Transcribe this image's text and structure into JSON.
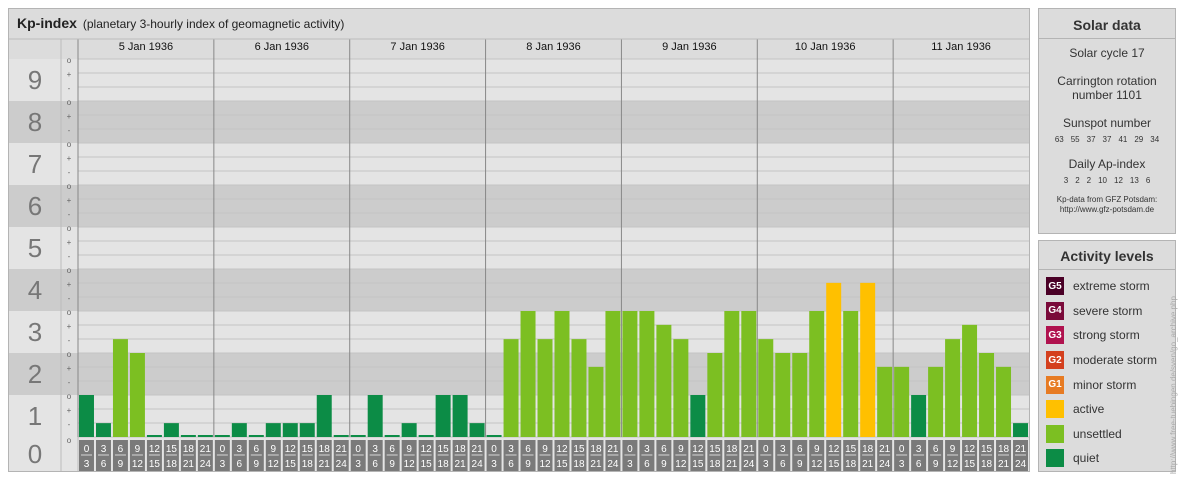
{
  "header": {
    "title": "Kp-index",
    "subtitle": "(planetary 3-hourly index of geomagnetic activity)"
  },
  "solar": {
    "title": "Solar data",
    "cycle": "Solar cycle 17",
    "carrington": "Carrington rotation number 1101",
    "sunspot_label": "Sunspot number",
    "sunspot_values": [
      "63",
      "55",
      "37",
      "37",
      "41",
      "29",
      "34"
    ],
    "ap_label": "Daily Ap-index",
    "ap_values": [
      "3",
      "2",
      "2",
      "10",
      "12",
      "13",
      "6"
    ],
    "source": "Kp-data from GFZ Potsdam:",
    "source_url": "http://www.gfz-potsdam.de"
  },
  "activity": {
    "title": "Activity levels",
    "levels": [
      {
        "code": "G5",
        "label": "extreme storm",
        "color": "#4a0026"
      },
      {
        "code": "G4",
        "label": "severe storm",
        "color": "#7a0a3a"
      },
      {
        "code": "G3",
        "label": "strong storm",
        "color": "#b0124e"
      },
      {
        "code": "G2",
        "label": "moderate storm",
        "color": "#d4401e"
      },
      {
        "code": "G1",
        "label": "minor storm",
        "color": "#e77b22"
      },
      {
        "code": "",
        "label": "active",
        "color": "#ffc000"
      },
      {
        "code": "",
        "label": "unsettled",
        "color": "#7cbf22"
      },
      {
        "code": "",
        "label": "quiet",
        "color": "#0c8c46"
      }
    ]
  },
  "watermark": "http://www.free-tuebingen.de/sven/go_archive.php",
  "chart_data": {
    "type": "bar",
    "title": "Kp-index",
    "ylim": [
      0,
      9
    ],
    "y_ticks": [
      "0",
      "1",
      "2",
      "3",
      "4",
      "5",
      "6",
      "7",
      "8",
      "9"
    ],
    "sub_ticks": [
      "o",
      "-",
      "+"
    ],
    "days": [
      "5 Jan 1936",
      "6 Jan 1936",
      "7 Jan 1936",
      "8 Jan 1936",
      "9 Jan 1936",
      "10 Jan 1936",
      "11 Jan 1936"
    ],
    "interval_start": [
      "0",
      "3",
      "6",
      "9",
      "12",
      "15",
      "18",
      "21"
    ],
    "interval_end": [
      "3",
      "6",
      "9",
      "12",
      "15",
      "18",
      "21",
      "24"
    ],
    "values": [
      1.0,
      0.33,
      2.33,
      2.0,
      0,
      0.33,
      0,
      0,
      0,
      0.33,
      0,
      0.33,
      0.33,
      0.33,
      1.0,
      0,
      0,
      1.0,
      0,
      0.33,
      0,
      1.0,
      1.0,
      0.33,
      0,
      2.33,
      3.0,
      2.33,
      3.0,
      2.33,
      1.67,
      3.0,
      3.0,
      3.0,
      2.67,
      2.33,
      1.0,
      2.0,
      3.0,
      3.0,
      2.33,
      2.0,
      2.0,
      3.0,
      3.67,
      3.0,
      3.67,
      1.67,
      1.67,
      1.0,
      1.67,
      2.33,
      2.67,
      2.0,
      1.67,
      0.33
    ],
    "colors": {
      "quiet": "#0c8c46",
      "unsettled": "#7cbf22",
      "active": "#ffc000"
    },
    "grid": true
  }
}
